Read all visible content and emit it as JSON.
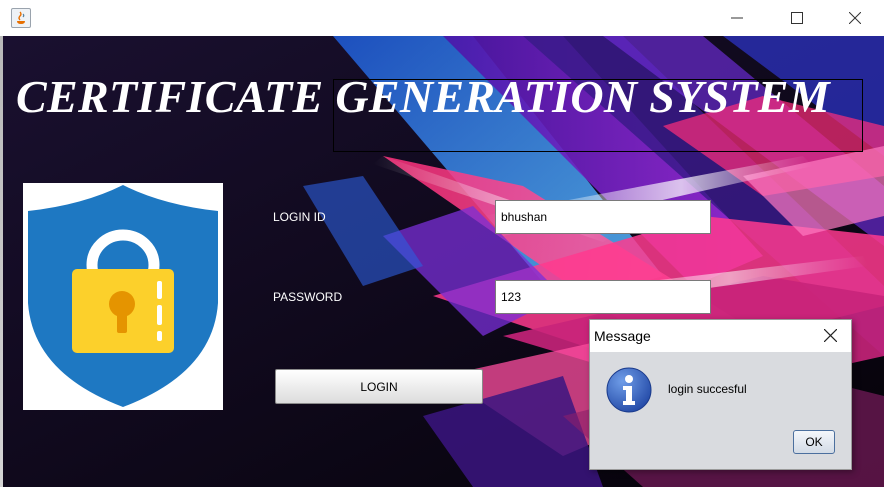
{
  "window": {
    "title": "",
    "controls": [
      "minimize-icon",
      "maximize-icon",
      "close-icon"
    ]
  },
  "app": {
    "heading": "CERTIFICATE GENERATION SYSTEM",
    "logo": "shield-lock-icon"
  },
  "form": {
    "login_id_label": "LOGIN ID",
    "login_id_value": "bhushan",
    "password_label": "PASSWORD",
    "password_value": "123",
    "login_button": "LOGIN"
  },
  "dialog": {
    "title": "Message",
    "icon": "info-icon",
    "message": "login succesful",
    "ok_button": "OK"
  },
  "colors": {
    "shield_blue": "#1e78c2",
    "lock_yellow": "#fcd02b",
    "keyhole_orange": "#e59400",
    "info_blue": "#2a57b5",
    "background_dark": "#0c0718"
  }
}
